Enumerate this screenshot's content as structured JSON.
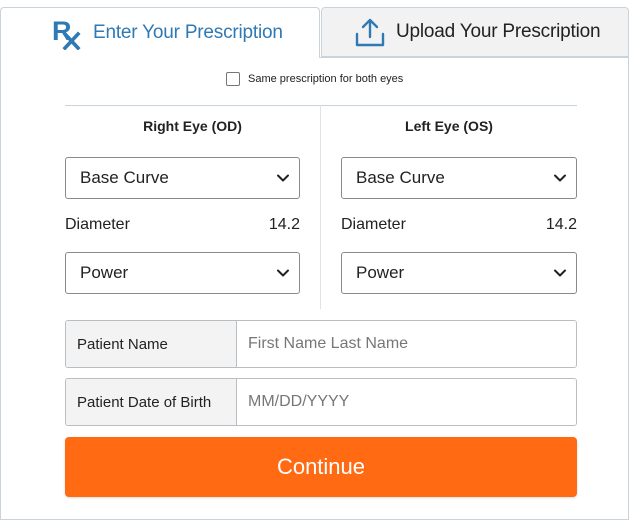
{
  "tabs": {
    "enter": {
      "label": "Enter Your Prescription",
      "icon": "rx-icon",
      "active": true
    },
    "upload": {
      "label": "Upload Your Prescription",
      "icon": "upload-icon",
      "active": false
    }
  },
  "same_prescription": {
    "label": "Same prescription for both eyes",
    "checked": false
  },
  "right_eye": {
    "heading": "Right Eye (OD)",
    "base_curve": "Base Curve",
    "diameter_label": "Diameter",
    "diameter_value": "14.2",
    "power": "Power"
  },
  "left_eye": {
    "heading": "Left Eye (OS)",
    "base_curve": "Base Curve",
    "diameter_label": "Diameter",
    "diameter_value": "14.2",
    "power": "Power"
  },
  "patient_name": {
    "label": "Patient Name",
    "placeholder": "First Name Last Name"
  },
  "patient_dob": {
    "label": "Patient Date of Birth",
    "placeholder": "MM/DD/YYYY"
  },
  "continue_label": "Continue",
  "colors": {
    "accent": "#2f79b5",
    "button": "#ff6a13",
    "border": "#c9d3dc"
  }
}
